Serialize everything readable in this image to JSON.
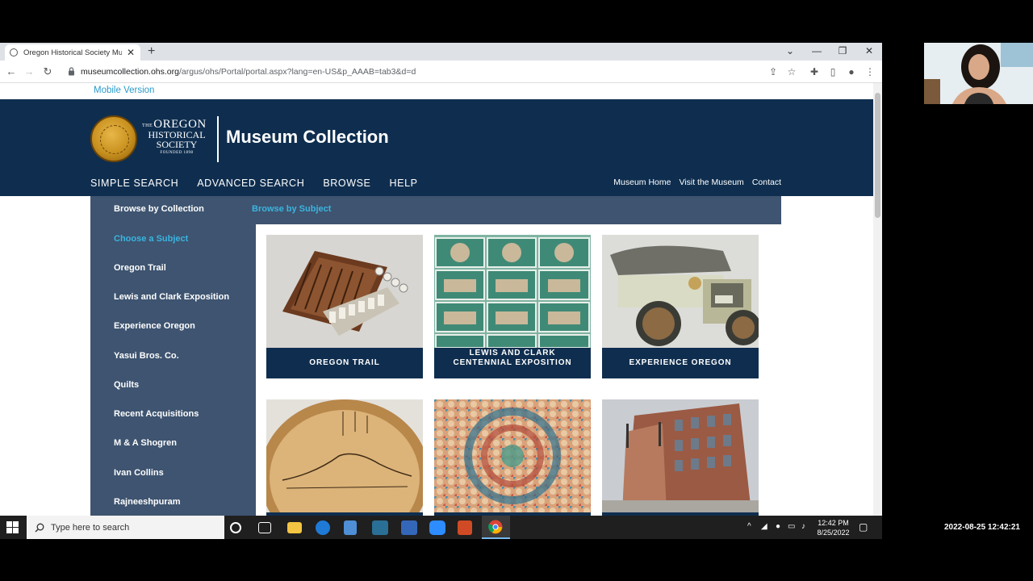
{
  "browser": {
    "tab_title": "Oregon Historical Society Museu",
    "url_host": "museumcollection.ohs.org",
    "url_path": "/argus/ohs/Portal/portal.aspx?lang=en-US&p_AAAB=tab3&d=d"
  },
  "site": {
    "mobile_link": "Mobile Version",
    "logo": {
      "the": "THE",
      "line1": "OREGON",
      "line2": "HISTORICAL",
      "line3": "SOCIETY",
      "line4": "FOUNDED 1898"
    },
    "title": "Museum Collection",
    "main_nav": [
      "SIMPLE SEARCH",
      "ADVANCED SEARCH",
      "BROWSE",
      "HELP"
    ],
    "util_nav": [
      "Museum Home",
      "Visit the Museum",
      "Contact"
    ]
  },
  "browse": {
    "tab_collection": "Browse by Collection",
    "tab_subject": "Browse by Subject",
    "sidebar": [
      {
        "label": "Choose a Subject",
        "active": true
      },
      {
        "label": "Oregon Trail"
      },
      {
        "label": "Lewis and Clark Exposition"
      },
      {
        "label": "Experience Oregon"
      },
      {
        "label": "Yasui Bros. Co."
      },
      {
        "label": "Quilts"
      },
      {
        "label": "Recent Acquisitions"
      },
      {
        "label": "M & A Shogren"
      },
      {
        "label": "Ivan Collins"
      },
      {
        "label": "Rajneeshpuram"
      }
    ],
    "tiles": [
      {
        "caption": "OREGON TRAIL"
      },
      {
        "caption": "LEWIS AND CLARK CENTENNIAL EXPOSITION"
      },
      {
        "caption": "EXPERIENCE OREGON"
      },
      {
        "caption": ""
      },
      {
        "caption": ""
      },
      {
        "caption": ""
      }
    ]
  },
  "taskbar": {
    "search_placeholder": "Type here to search",
    "time": "12:42 PM",
    "date": "8/25/2022"
  },
  "overlay": {
    "timestamp": "2022-08-25 12:42:21"
  },
  "colors": {
    "header_bg": "#0f2e4f",
    "panel_bg": "#3e5470",
    "accent": "#3bb4df"
  }
}
